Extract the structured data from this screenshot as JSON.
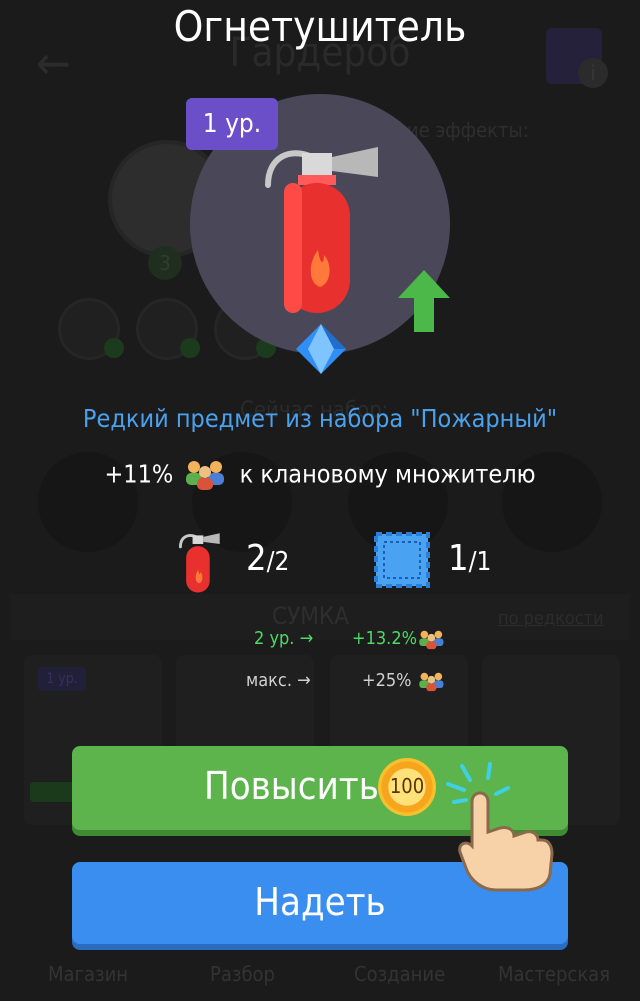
{
  "background": {
    "screen_title": "Гардероб",
    "effects_label": "щие эффекты:",
    "player_level": "3",
    "current_set_label": "Сейчас набор:",
    "bag_title": "СУМКА",
    "sort_label": "по редкости",
    "card_level": "1 ур.",
    "nav": [
      "Магазин",
      "Разбор",
      "Создание",
      "Мастерская"
    ]
  },
  "popup": {
    "title": "Огнетушитель",
    "level_badge": "1 ур.",
    "rarity_text": "Редкий предмет из набора \"Пожарный\"",
    "multiplier_prefix": "+11%",
    "multiplier_suffix": "к клановому множителю",
    "set_items": [
      {
        "icon": "fire-extinguisher-icon",
        "count": "2",
        "total": "/2"
      },
      {
        "icon": "blue-patch-icon",
        "count": "1",
        "total": "/1"
      }
    ],
    "upgrade_preview": [
      {
        "level": "2 ур. →",
        "value": "+13.2%"
      },
      {
        "level": "макс. →",
        "value": "+25%"
      }
    ],
    "upgrade_button": "Повысить",
    "upgrade_cost": "100",
    "equip_button": "Надеть"
  },
  "colors": {
    "accent_upgrade": "#5db44d",
    "accent_equip": "#3a8ef0",
    "rarity": "#4aa2ee",
    "level_badge": "#6a4fc9",
    "preview_green": "#4cd964"
  }
}
